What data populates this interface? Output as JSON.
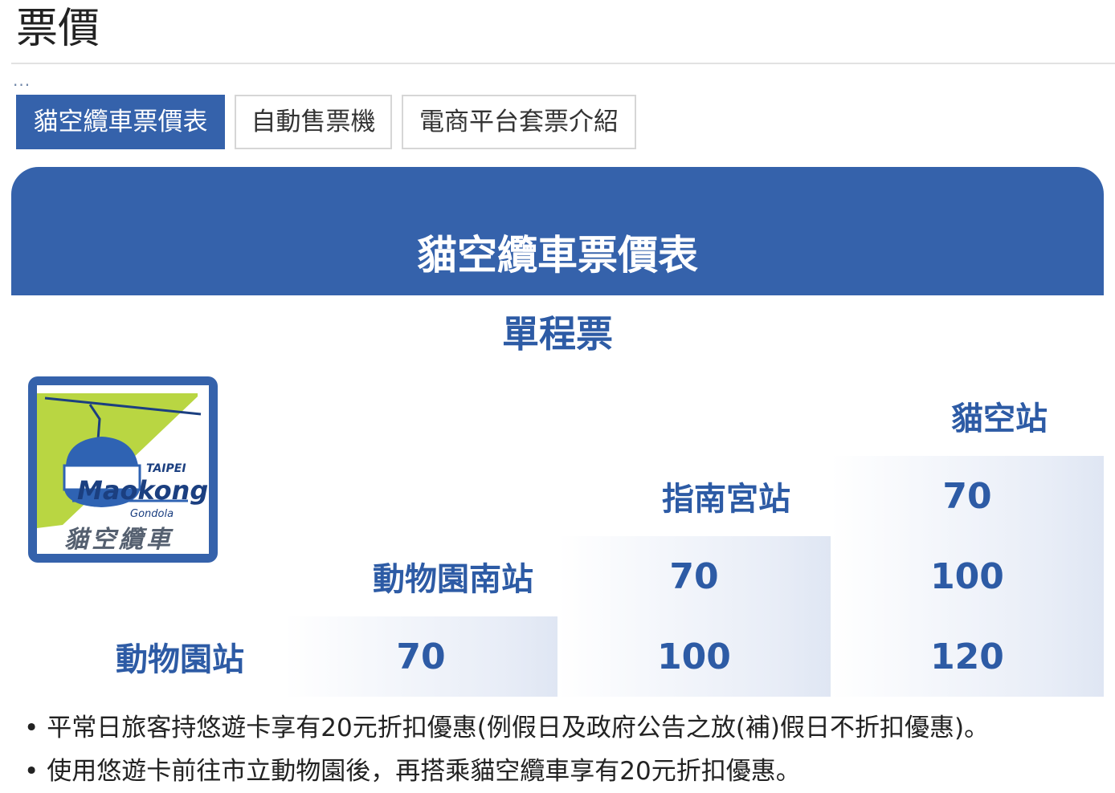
{
  "page": {
    "title": "票價"
  },
  "ellipsis": "...",
  "tabs": [
    {
      "label": "貓空纜車票價表",
      "active": true
    },
    {
      "label": "自動售票機",
      "active": false
    },
    {
      "label": "電商平台套票介紹",
      "active": false
    }
  ],
  "banner": {
    "title": "貓空纜車票價表"
  },
  "fare_table": {
    "subtitle": "單程票",
    "stations": {
      "maokong": "貓空站",
      "zhinan": "指南宮站",
      "zoo_south": "動物園南站",
      "zoo": "動物園站"
    },
    "prices": {
      "zhinan_maokong": "70",
      "zoo_south_zhinan": "70",
      "zoo_south_maokong": "100",
      "zoo_zoo_south": "70",
      "zoo_zhinan": "100",
      "zoo_maokong": "120"
    }
  },
  "logo": {
    "taipei": "TAIPEI",
    "maokong": "Maokong",
    "gondola": "Gondola",
    "chinese": "貓空纜車"
  },
  "notes": [
    "平常日旅客持悠遊卡享有20元折扣優惠(例假日及政府公告之放(補)假日不折扣優惠)。",
    "使用悠遊卡前往市立動物園後，再搭乘貓空纜車享有20元折扣優惠。"
  ],
  "colors": {
    "brand": "#3562ab",
    "text_blue": "#2d5ba5",
    "logo_green": "#b9d642"
  }
}
